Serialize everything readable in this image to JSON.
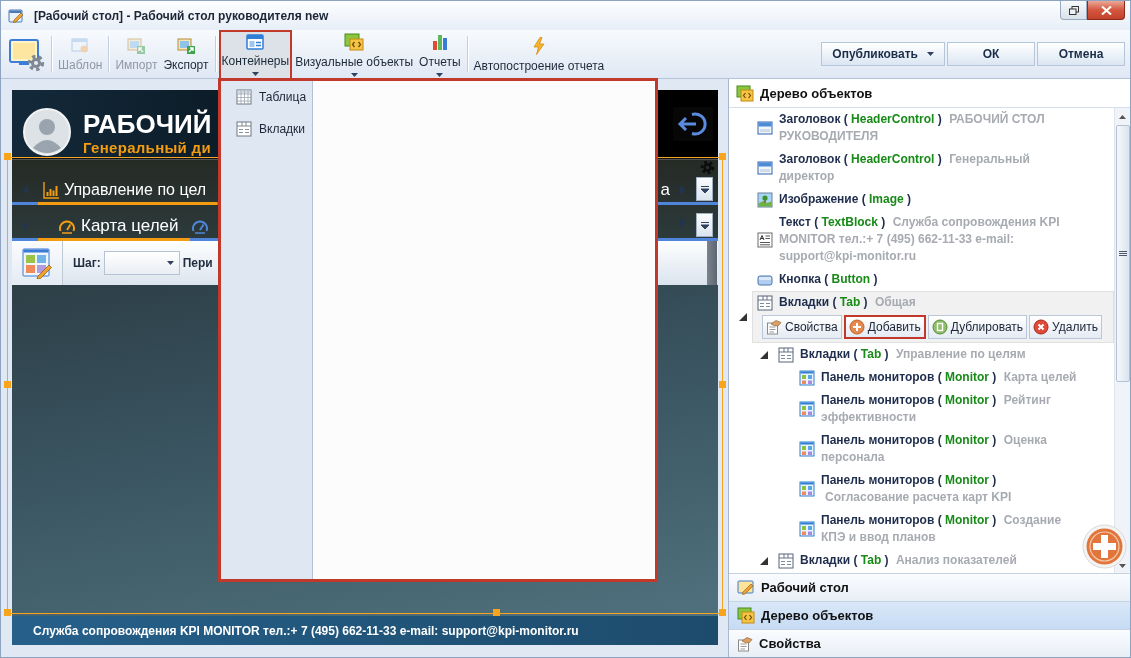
{
  "window": {
    "title": "[Рабочий стол] - Рабочий стол руководителя new"
  },
  "toolbar": {
    "groups": [
      [
        {
          "kind": "desktop-settings",
          "disabled": false,
          "highlighted": false,
          "dropdown": false
        }
      ],
      [
        {
          "kind": "template",
          "label": "Шаблон",
          "disabled": true,
          "highlighted": false,
          "dropdown": false
        }
      ],
      [
        {
          "kind": "import",
          "label": "Импорт",
          "disabled": true,
          "highlighted": false,
          "dropdown": false
        },
        {
          "kind": "export",
          "label": "Экспорт",
          "disabled": false,
          "highlighted": false,
          "dropdown": false
        }
      ],
      [
        {
          "kind": "containers",
          "label": "Контейнеры",
          "disabled": false,
          "highlighted": true,
          "dropdown": true
        },
        {
          "kind": "visual-objects",
          "label": "Визуальные объекты",
          "disabled": false,
          "highlighted": false,
          "dropdown": true
        },
        {
          "kind": "reports",
          "label": "Отчеты",
          "disabled": false,
          "highlighted": false,
          "dropdown": true
        }
      ],
      [
        {
          "kind": "auto-build",
          "label": "Автопостроение отчета",
          "disabled": false,
          "highlighted": false,
          "dropdown": false
        }
      ]
    ],
    "actions": [
      {
        "label": "Опубликовать",
        "dropdown": true
      },
      {
        "label": "ОК",
        "dropdown": false
      },
      {
        "label": "Отмена",
        "dropdown": false
      }
    ]
  },
  "containers_menu": {
    "items": [
      {
        "kind": "table",
        "label": "Таблица"
      },
      {
        "kind": "tabs",
        "label": "Вкладки"
      }
    ]
  },
  "preview": {
    "title": "РАБОЧИЙ",
    "subtitle": "Генеральный ди",
    "tab_rows": [
      {
        "tabs": [
          {
            "kind": "chart",
            "label": "Управление по цел",
            "selected": true
          }
        ],
        "tail": "а"
      },
      {
        "tabs": [
          {
            "kind": "gauge",
            "label": "Карта целей",
            "selected": true
          },
          {
            "kind": "gauge",
            "selected": false
          }
        ]
      }
    ],
    "step_label": "Шаг:",
    "period_label": "Пери",
    "footer": "Служба сопровождения KPI MONITOR тел.:+ 7 (495) 662-11-33 e-mail: support@kpi-monitor.ru"
  },
  "object_tree": {
    "title": "Дерево объектов",
    "items": [
      {
        "kind": "header",
        "name": "Заголовок",
        "type": "( HeaderControl )",
        "caption": "РАБОЧИЙ СТОЛ РУКОВОДИТЕЛЯ",
        "selected": false
      },
      {
        "kind": "header",
        "name": "Заголовок",
        "type": "( HeaderControl )",
        "caption": "Генеральный директор",
        "selected": false
      },
      {
        "kind": "image",
        "name": "Изображение",
        "type": "( Image )",
        "selected": false
      },
      {
        "kind": "text",
        "name": "Текст",
        "type": "( TextBlock )",
        "caption": "Служба сопровождения KPI MONITOR тел.:+ 7 (495) 662-11-33 e-mail: support@kpi-monitor.ru",
        "selected": false
      },
      {
        "kind": "button",
        "name": "Кнопка",
        "type": "( Button )",
        "selected": false
      },
      {
        "kind": "tab",
        "name": "Вкладки",
        "type": "( Tab )",
        "caption": "Общая",
        "selected": true,
        "expanded": true,
        "children": [
          {
            "kind": "tab",
            "name": "Вкладки",
            "type": "( Tab )",
            "caption": "Управление по целям",
            "selected": false,
            "expanded": true,
            "children": [
              {
                "kind": "monitor",
                "name": "Панель мониторов",
                "type": "( Monitor )",
                "caption": "Карта целей",
                "selected": false
              },
              {
                "kind": "monitor",
                "name": "Панель мониторов",
                "type": "( Monitor )",
                "caption": "Рейтинг эффективности",
                "selected": false
              },
              {
                "kind": "monitor",
                "name": "Панель мониторов",
                "type": "( Monitor )",
                "caption": "Оценка персонала",
                "selected": false
              },
              {
                "kind": "monitor",
                "name": "Панель мониторов",
                "type": "( Monitor )",
                "caption": "Согласование расчета карт KPI",
                "selected": false
              },
              {
                "kind": "monitor",
                "name": "Панель мониторов",
                "type": "( Monitor )",
                "caption": "Создание КПЭ и ввод планов",
                "selected": false
              }
            ]
          },
          {
            "kind": "tab",
            "name": "Вкладки",
            "type": "( Tab )",
            "caption": "Анализ показателей",
            "selected": false,
            "expanded": true
          }
        ]
      }
    ],
    "actions": [
      {
        "kind": "properties",
        "label": "Свойства",
        "highlighted": false
      },
      {
        "kind": "add",
        "label": "Добавить",
        "highlighted": true
      },
      {
        "kind": "duplicate",
        "label": "Дублировать",
        "highlighted": false
      },
      {
        "kind": "delete",
        "label": "Удалить",
        "highlighted": false
      }
    ]
  },
  "panels": [
    {
      "kind": "desktop",
      "label": "Рабочий стол",
      "selected": false
    },
    {
      "kind": "tree",
      "label": "Дерево объектов",
      "selected": true
    },
    {
      "kind": "properties",
      "label": "Свойства",
      "selected": false
    }
  ]
}
